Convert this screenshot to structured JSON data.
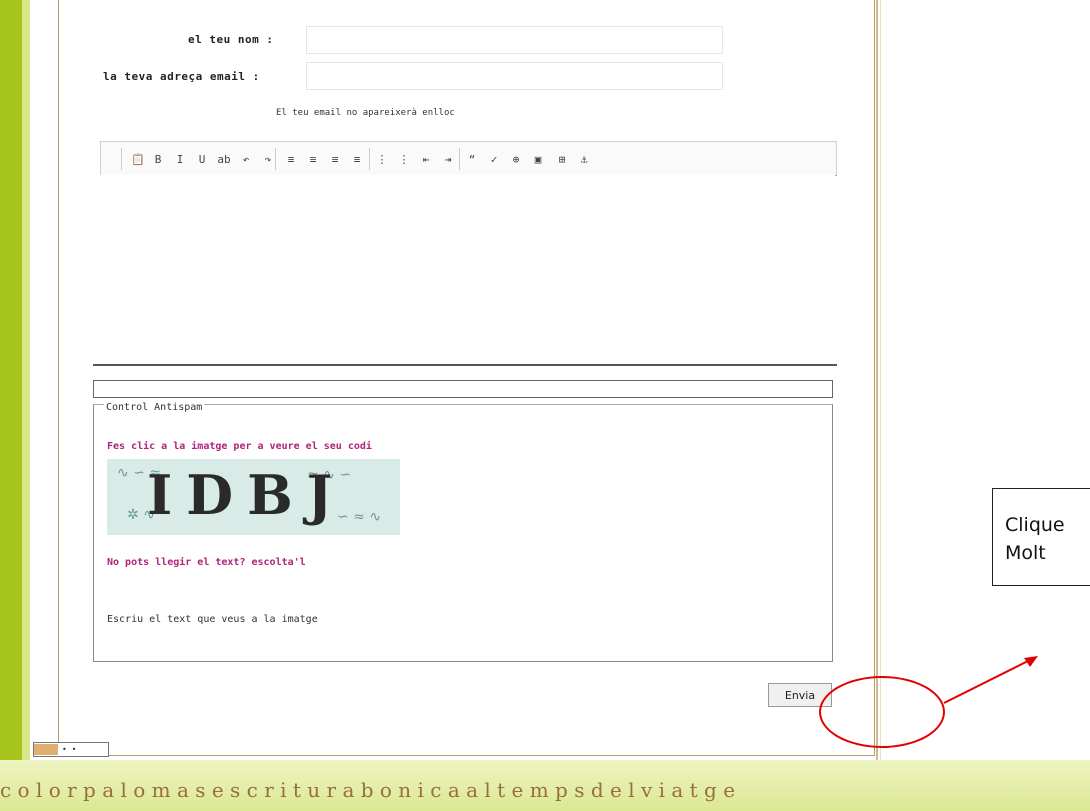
{
  "form": {
    "name_label": "el teu nom :",
    "email_label": "la teva adreça email :",
    "email_note": "El teu email no apareixerà enlloc",
    "name_value": "",
    "email_value": "",
    "subject_value": ""
  },
  "toolbar": {
    "buttons": [
      "paste-icon",
      "bold-icon",
      "italic-icon",
      "underline-icon",
      "strikethrough-icon",
      "undo-icon",
      "redo-icon",
      "align-left-icon",
      "align-center-icon",
      "align-right-icon",
      "align-justify-icon",
      "ordered-list-icon",
      "unordered-list-icon",
      "outdent-icon",
      "indent-icon",
      "quote-icon",
      "spellcheck-icon",
      "link-icon",
      "image-icon",
      "table-icon",
      "anchor-icon"
    ],
    "glyphs": [
      "📋",
      "B",
      "I",
      "U",
      "ab",
      "↶",
      "↷",
      "≡",
      "≡",
      "≡",
      "≡",
      "⋮",
      "⋮",
      "⇤",
      "⇥",
      "“",
      "✓",
      "⊕",
      "▣",
      "⊞",
      "⚓"
    ]
  },
  "antispam": {
    "legend": "Control Antispam",
    "click_text": "Fes clic a la imatge per a veure el seu codi",
    "captcha_code": "IDBJ",
    "cant_read_text": "No pots llegir el text? escolta'l",
    "write_text": "Escriu el text que veus a la imatge"
  },
  "send_button": "Envia",
  "widget": {
    "label": "• •"
  },
  "callout": {
    "line1": "Clique",
    "line2": "Molt"
  },
  "band_text": "c o l o r p a l o m a s e s c r i t u r a b o n i c a a l t e m p s d e l v i a t g e"
}
